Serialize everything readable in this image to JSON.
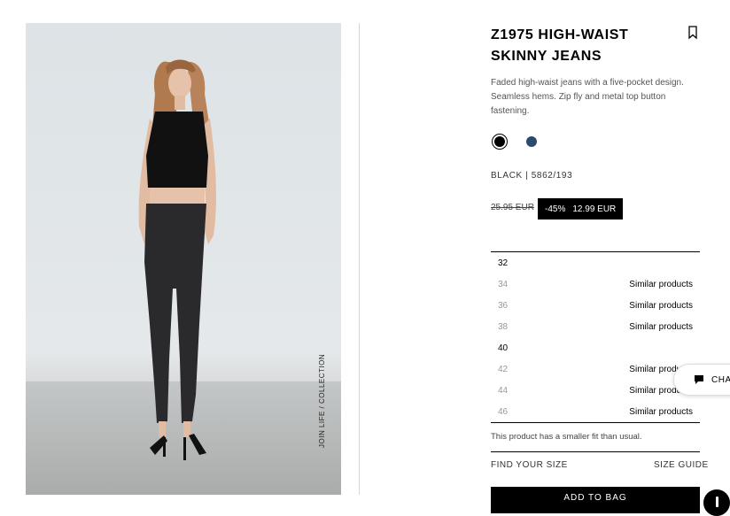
{
  "product": {
    "title": "Z1975 HIGH-WAIST SKINNY JEANS",
    "description": "Faded high-waist jeans with a five-pocket design. Seamless hems. Zip fly and metal top button fastening.",
    "image_watermark": "JOIN LIFE / COLLECTION",
    "colors": [
      {
        "name": "black-swatch",
        "hex": "#000000",
        "selected": true
      },
      {
        "name": "blue-swatch",
        "hex": "#2c4a6e",
        "selected": false
      }
    ],
    "color_ref": "BLACK | 5862/193",
    "old_price": "25.95 EUR",
    "discount": "-45%",
    "new_price": "12.99 EUR"
  },
  "sizes": [
    {
      "size": "32",
      "similar": ""
    },
    {
      "size": "34",
      "similar": "Similar products"
    },
    {
      "size": "36",
      "similar": "Similar products"
    },
    {
      "size": "38",
      "similar": "Similar products"
    },
    {
      "size": "40",
      "similar": ""
    },
    {
      "size": "42",
      "similar": "Similar products"
    },
    {
      "size": "44",
      "similar": "Similar products"
    },
    {
      "size": "46",
      "similar": "Similar products"
    }
  ],
  "fit_note": "This product has a smaller fit than usual.",
  "find_size_label": "FIND YOUR SIZE",
  "size_guide_label": "SIZE GUIDE",
  "add_to_bag_label": "ADD TO BAG",
  "chat_label": "CHAT",
  "icons": {
    "bookmark": "bookmark-icon",
    "chat": "chat-bubble-icon",
    "info": "info-icon"
  }
}
